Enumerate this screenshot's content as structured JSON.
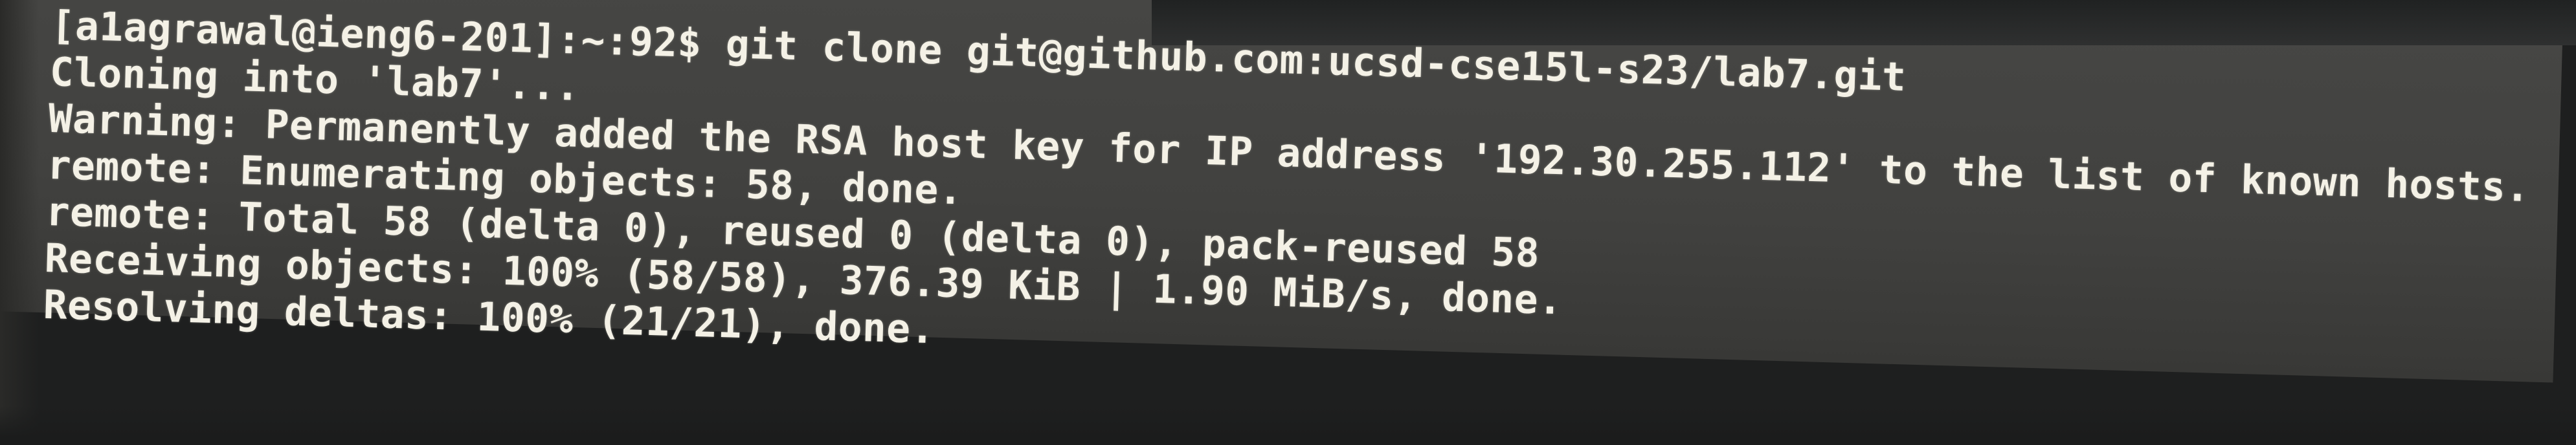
{
  "terminal": {
    "lines": [
      "[a1agrawal@ieng6-201]:~:92$ git clone git@github.com:ucsd-cse15l-s23/lab7.git",
      "Cloning into 'lab7'...",
      "Warning: Permanently added the RSA host key for IP address '192.30.255.112' to the list of known hosts.",
      "remote: Enumerating objects: 58, done.",
      "remote: Total 58 (delta 0), reused 0 (delta 0), pack-reused 58",
      "Receiving objects: 100% (58/58), 376.39 KiB | 1.90 MiB/s, done.",
      "Resolving deltas: 100% (21/21), done."
    ]
  }
}
